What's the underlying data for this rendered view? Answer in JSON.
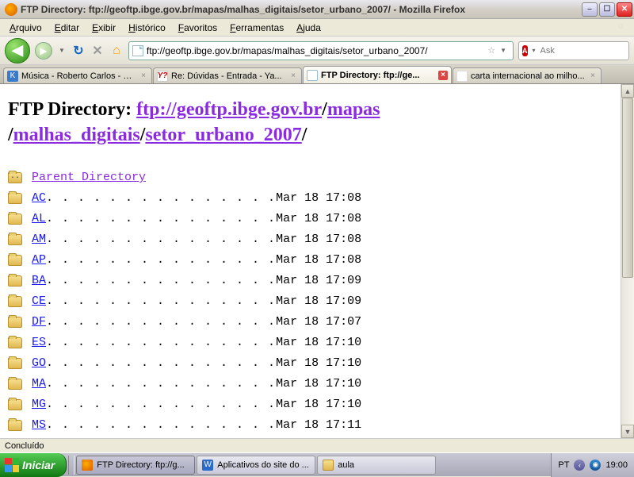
{
  "window": {
    "title": "FTP Directory: ftp://geoftp.ibge.gov.br/mapas/malhas_digitais/setor_urbano_2007/ - Mozilla Firefox"
  },
  "menu": {
    "items": [
      {
        "u": "A",
        "rest": "rquivo"
      },
      {
        "u": "E",
        "rest": "ditar"
      },
      {
        "u": "E",
        "rest": "xibir"
      },
      {
        "u": "H",
        "rest": "istórico"
      },
      {
        "u": "F",
        "rest": "avoritos"
      },
      {
        "u": "F",
        "rest": "erramentas"
      },
      {
        "u": "A",
        "rest": "juda"
      }
    ]
  },
  "nav": {
    "url": "ftp://geoftp.ibge.gov.br/mapas/malhas_digitais/setor_urbano_2007/",
    "search_placeholder": "Ask"
  },
  "tabs": [
    {
      "favclass": "fav-k",
      "favtext": "K",
      "label": "Música - Roberto Carlos - K...",
      "active": false
    },
    {
      "favclass": "fav-y",
      "favtext": "Y?",
      "label": "Re: Dúvidas - Entrada - Ya...",
      "active": false
    },
    {
      "favclass": "fav-page",
      "favtext": "",
      "label": "FTP Directory: ftp://ge...",
      "active": true
    },
    {
      "favclass": "fav-g",
      "favtext": "",
      "label": "carta internacional ao milho...",
      "active": false
    }
  ],
  "heading": {
    "prefix": "FTP Directory: ",
    "parts": [
      "ftp://geoftp.ibge.gov.br",
      "mapas",
      "malhas_digitais",
      "setor_urbano_2007"
    ]
  },
  "parent_label": "Parent Directory",
  "entries": [
    {
      "name": "AC",
      "dots": ". . . . . . . . . . . . . . .",
      "ts": "Mar 18 17:08"
    },
    {
      "name": "AL",
      "dots": ". . . . . . . . . . . . . . .",
      "ts": "Mar 18 17:08"
    },
    {
      "name": "AM",
      "dots": ". . . . . . . . . . . . . . .",
      "ts": "Mar 18 17:08"
    },
    {
      "name": "AP",
      "dots": ". . . . . . . . . . . . . . .",
      "ts": "Mar 18 17:08"
    },
    {
      "name": "BA",
      "dots": ". . . . . . . . . . . . . . .",
      "ts": "Mar 18 17:09"
    },
    {
      "name": "CE",
      "dots": ". . . . . . . . . . . . . . .",
      "ts": "Mar 18 17:09"
    },
    {
      "name": "DF",
      "dots": ". . . . . . . . . . . . . . .",
      "ts": "Mar 18 17:07"
    },
    {
      "name": "ES",
      "dots": ". . . . . . . . . . . . . . .",
      "ts": "Mar 18 17:10"
    },
    {
      "name": "GO",
      "dots": ". . . . . . . . . . . . . . .",
      "ts": "Mar 18 17:10"
    },
    {
      "name": "MA",
      "dots": ". . . . . . . . . . . . . . .",
      "ts": "Mar 18 17:10"
    },
    {
      "name": "MG",
      "dots": ". . . . . . . . . . . . . . .",
      "ts": "Mar 18 17:10"
    },
    {
      "name": "MS",
      "dots": ". . . . . . . . . . . . . . .",
      "ts": "Mar 18 17:11"
    }
  ],
  "status": {
    "text": "Concluído"
  },
  "taskbar": {
    "start": "Iniciar",
    "items": [
      {
        "iconclass": "ti-ff",
        "icontext": "",
        "label": "FTP Directory: ftp://g...",
        "active": true
      },
      {
        "iconclass": "ti-word",
        "icontext": "W",
        "label": "Aplicativos do site do ...",
        "active": false
      },
      {
        "iconclass": "ti-folder",
        "icontext": "",
        "label": "aula",
        "active": false
      }
    ],
    "lang": "PT",
    "clock": "19:00"
  }
}
